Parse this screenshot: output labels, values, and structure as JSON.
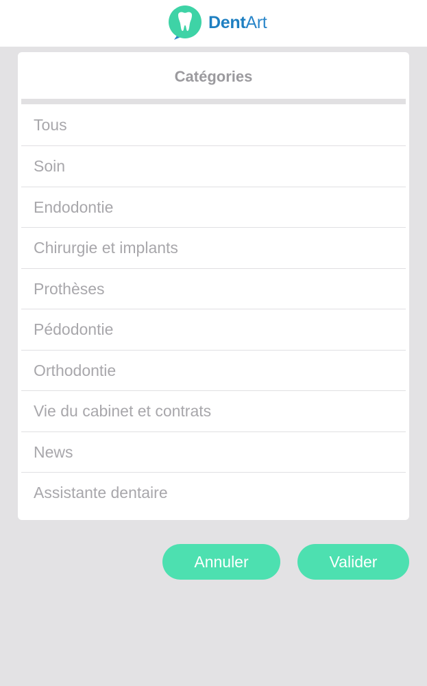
{
  "app": {
    "brand_part1": "Dent",
    "brand_part2": "Art",
    "brand_color": "#1e7fc1",
    "logo_icon": "tooth-chat-bubble-icon",
    "logo_color": "#3ed3a6"
  },
  "dialog": {
    "title": "Catégories",
    "items": [
      {
        "label": "Tous"
      },
      {
        "label": "Soin"
      },
      {
        "label": "Endodontie"
      },
      {
        "label": "Chirurgie et implants"
      },
      {
        "label": "Prothèses"
      },
      {
        "label": "Pédodontie"
      },
      {
        "label": "Orthodontie"
      },
      {
        "label": "Vie du cabinet et contrats"
      },
      {
        "label": "News"
      },
      {
        "label": "Assistante dentaire"
      }
    ]
  },
  "actions": {
    "cancel_label": "Annuler",
    "validate_label": "Valider",
    "accent_color": "#4de0b0"
  }
}
